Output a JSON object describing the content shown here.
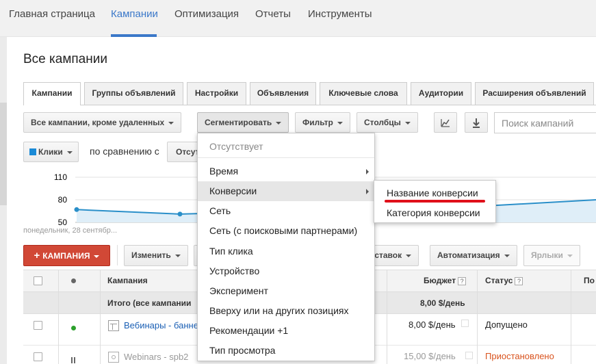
{
  "nav": {
    "items": [
      "Главная страница",
      "Кампании",
      "Оптимизация",
      "Отчеты",
      "Инструменты"
    ]
  },
  "page_title": "Все кампании",
  "tabs": [
    "Кампании",
    "Группы объявлений",
    "Настройки",
    "Объявления",
    "Ключевые слова",
    "Аудитории",
    "Расширения объявлений"
  ],
  "toolbar": {
    "filter_campaigns": "Все кампании, кроме удаленных",
    "segment": "Сегментировать",
    "filter": "Фильтр",
    "columns": "Столбцы",
    "search_placeholder": "Поиск кампаний"
  },
  "chart_controls": {
    "metric": "Клики",
    "compare_label": "по сравнению с",
    "compare_value": "Отсут"
  },
  "chart": {
    "y_ticks": [
      "110",
      "80",
      "50"
    ],
    "x_label": "понедельник, 28 сентябр..."
  },
  "chart_data": {
    "type": "line",
    "ylim": [
      50,
      110
    ],
    "series": [
      {
        "values": [
          67,
          61,
          72,
          80
        ]
      }
    ]
  },
  "actions": {
    "add_campaign": "КАМПАНИЯ",
    "edit": "Изменить",
    "bid_strategy": "я ставок",
    "automation": "Автоматизация",
    "labels": "Ярлыки"
  },
  "table": {
    "columns": {
      "campaign": "Кампания",
      "budget": "Бюджет",
      "status": "Статус",
      "more": "По"
    },
    "total_row": {
      "label": "Итого (все кампании",
      "budget": "8,00 $/день"
    },
    "rows": [
      {
        "name": "Вебинары - банне",
        "budget": "8,00 $/день",
        "status": "Допущено"
      },
      {
        "name": "Webinars - spb2",
        "budget": "15,00 $/день",
        "status": "Приостановлено"
      }
    ]
  },
  "segment_menu": {
    "items": [
      "Отсутствует",
      "Время",
      "Конверсии",
      "Сеть",
      "Сеть (с поисковыми партнерами)",
      "Тип клика",
      "Устройство",
      "Эксперимент",
      "Вверху или на других позициях",
      "Рекомендации +1",
      "Тип просмотра"
    ]
  },
  "conversions_submenu": {
    "items": [
      "Название конверсии",
      "Категория конверсии"
    ]
  },
  "colors": {
    "accent": "#3b78c9",
    "add_button": "#d14836",
    "line": "#2a8fc9",
    "paused": "#d9531e",
    "highlight": "#e0101a",
    "status_dot": "#2ca02c"
  }
}
